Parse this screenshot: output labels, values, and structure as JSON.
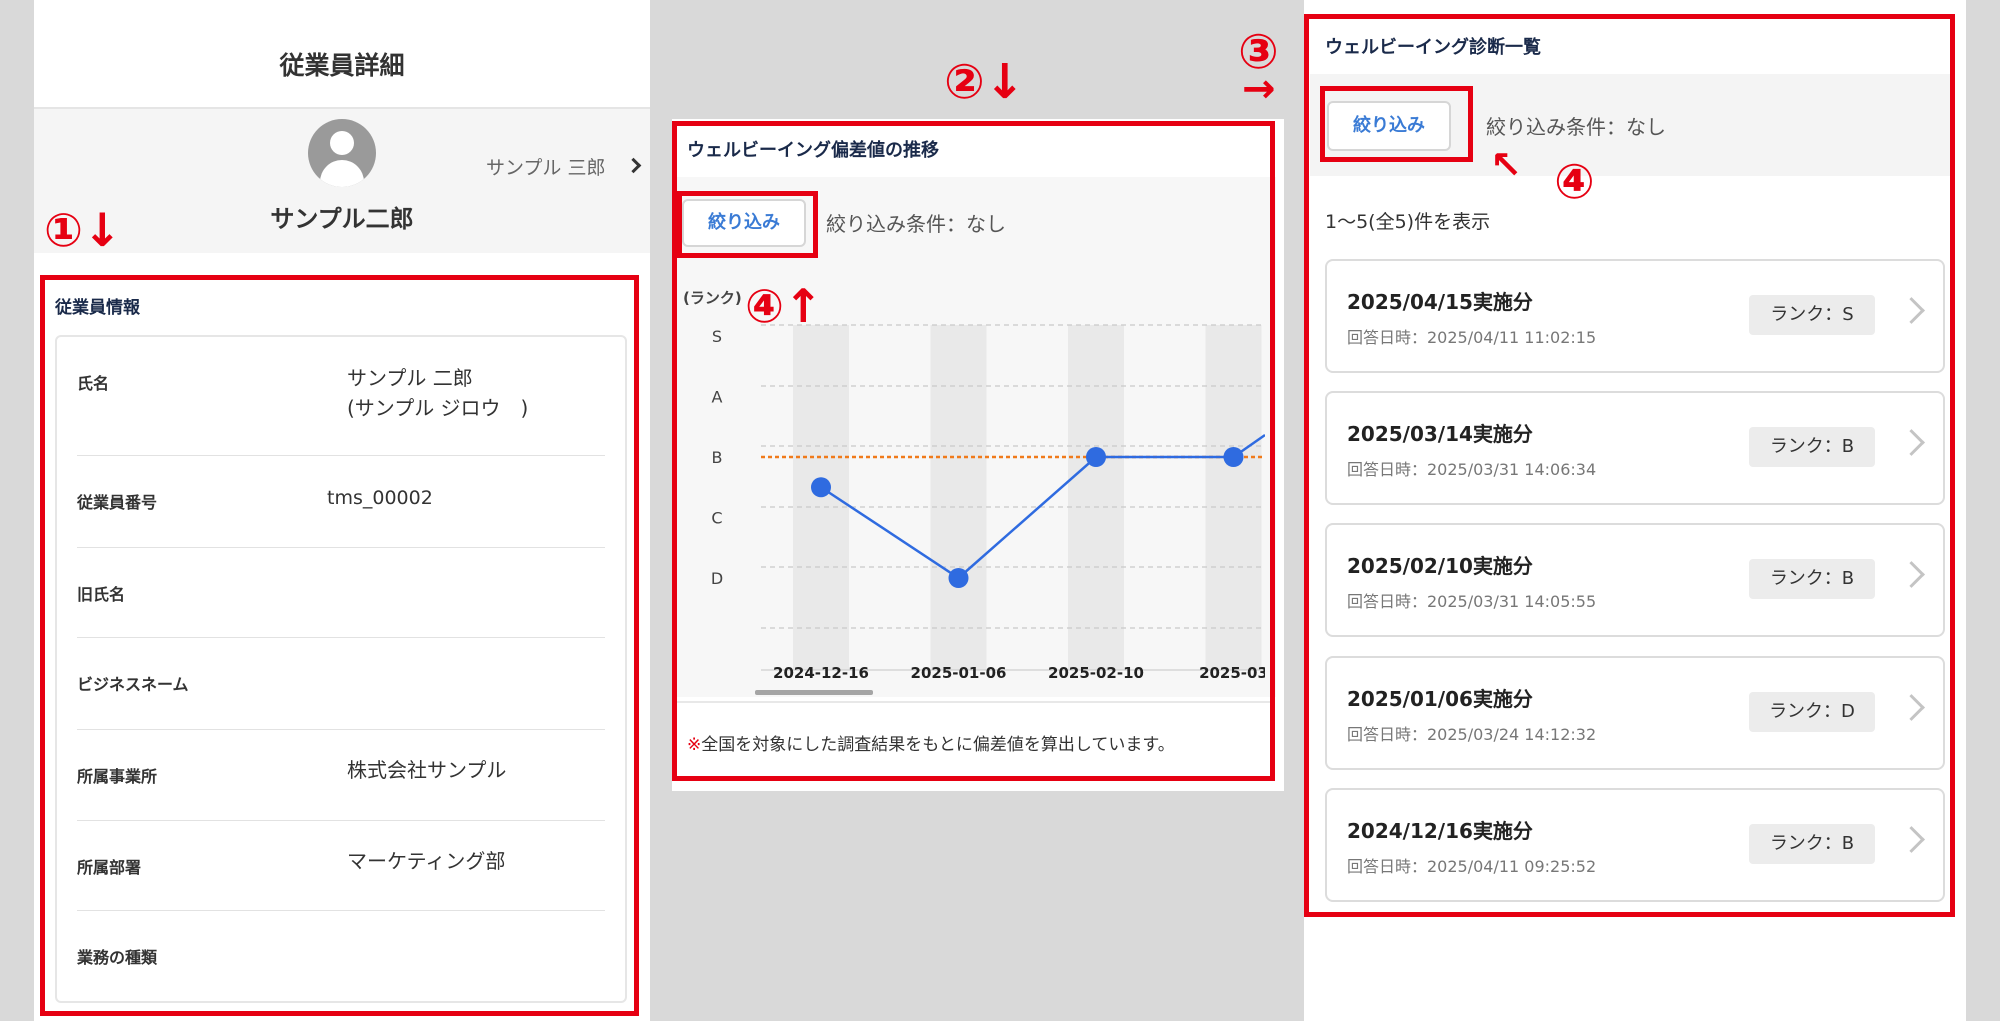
{
  "employee_detail": {
    "title": "従業員詳細",
    "name": "サンプル二郎",
    "switch_label": "サンプル 三郎",
    "section_title": "従業員情報",
    "fields": [
      {
        "label": "氏名",
        "value": "サンプル 二郎",
        "value2": "(サンプル ジロウ　)"
      },
      {
        "label": "従業員番号",
        "value": "tms_00002",
        "value2": ""
      },
      {
        "label": "旧氏名",
        "value": "",
        "value2": ""
      },
      {
        "label": "ビジネスネーム",
        "value": "",
        "value2": ""
      },
      {
        "label": "所属事業所",
        "value": "株式会社サンプル",
        "value2": ""
      },
      {
        "label": "所属部署",
        "value": "マーケティング部",
        "value2": ""
      },
      {
        "label": "業務の種類",
        "value": "",
        "value2": ""
      }
    ]
  },
  "wellbeing_chart": {
    "title": "ウェルビーイング偏差値の推移",
    "filter_button": "絞り込み",
    "filter_condition": "絞り込み条件：なし",
    "note_mark": "※",
    "note": "全国を対象にした調査結果をもとに偏差値を算出しています。"
  },
  "chart_data": {
    "type": "line",
    "ylabel": "(ランク)",
    "y_categories": [
      "S",
      "A",
      "B",
      "C",
      "D"
    ],
    "x": [
      "2024-12-16",
      "2025-01-06",
      "2025-02-10",
      "2025-03"
    ],
    "series": [
      {
        "values": [
          "C+",
          "D",
          "B",
          "B"
        ]
      }
    ],
    "reference_line": "B",
    "grid": true
  },
  "wellbeing_list": {
    "title": "ウェルビーイング診断一覧",
    "filter_button": "絞り込み",
    "filter_condition": "絞り込み条件：なし",
    "count_text": "1〜5(全5)件を表示",
    "items": [
      {
        "title": "2025/04/15実施分",
        "answered": "回答日時：2025/04/11 11:02:15",
        "rank": "ランク：S"
      },
      {
        "title": "2025/03/14実施分",
        "answered": "回答日時：2025/03/31 14:06:34",
        "rank": "ランク：B"
      },
      {
        "title": "2025/02/10実施分",
        "answered": "回答日時：2025/03/31 14:05:55",
        "rank": "ランク：B"
      },
      {
        "title": "2025/01/06実施分",
        "answered": "回答日時：2025/03/24 14:12:32",
        "rank": "ランク：D"
      },
      {
        "title": "2024/12/16実施分",
        "answered": "回答日時：2025/04/11 09:25:52",
        "rank": "ランク：B"
      }
    ]
  },
  "annotations": {
    "mark1": "①↓",
    "mark2": "②↓",
    "mark3": "③",
    "arrow3": "→",
    "mark4a": "④↑",
    "mark4b": "④",
    "arrow4b": "↖"
  },
  "colors": {
    "annotation_red": "#e60012",
    "accent_blue": "#3a7bd5",
    "line_blue": "#2f6be0",
    "reference_orange": "#f07a1a"
  }
}
